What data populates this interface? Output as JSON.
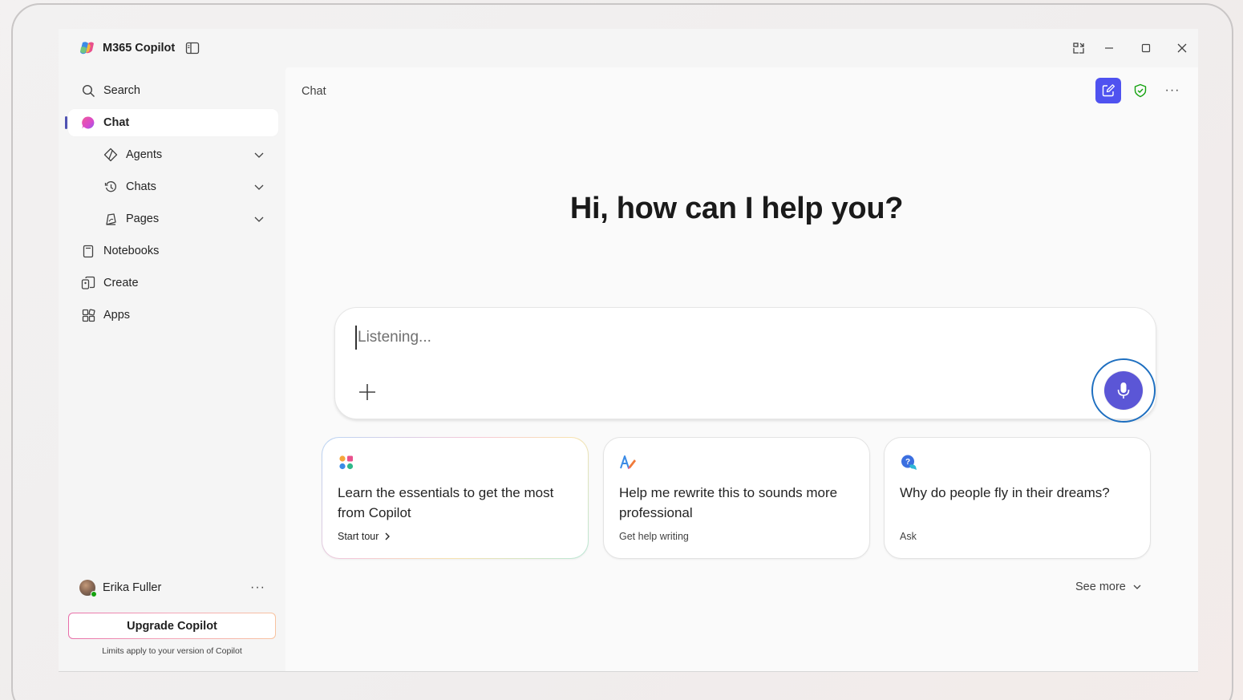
{
  "app": {
    "title": "M365 Copilot"
  },
  "sidebar": {
    "items": [
      {
        "label": "Search"
      },
      {
        "label": "Chat"
      },
      {
        "label": "Agents"
      },
      {
        "label": "Chats"
      },
      {
        "label": "Pages"
      },
      {
        "label": "Notebooks"
      },
      {
        "label": "Create"
      },
      {
        "label": "Apps"
      }
    ],
    "user": {
      "name": "Erika Fuller",
      "more": "···"
    },
    "upgrade_label": "Upgrade Copilot",
    "limits_note": "Limits apply to your version of Copilot"
  },
  "main": {
    "title": "Chat",
    "more": "···",
    "greeting": "Hi, how can I help you?",
    "composer": {
      "placeholder": "Listening..."
    },
    "cards": [
      {
        "text": "Learn the essentials to get the most from Copilot",
        "action": "Start tour"
      },
      {
        "text": "Help me rewrite this to sounds more professional",
        "action": "Get help writing"
      },
      {
        "text": "Why do people fly in their dreams?",
        "action": "Ask"
      }
    ],
    "see_more": "See more"
  },
  "colors": {
    "accent": "#4f52f0",
    "mic": "#5b56d6",
    "focus_ring": "#1e6fc0",
    "active_indicator": "#4f52b2"
  }
}
